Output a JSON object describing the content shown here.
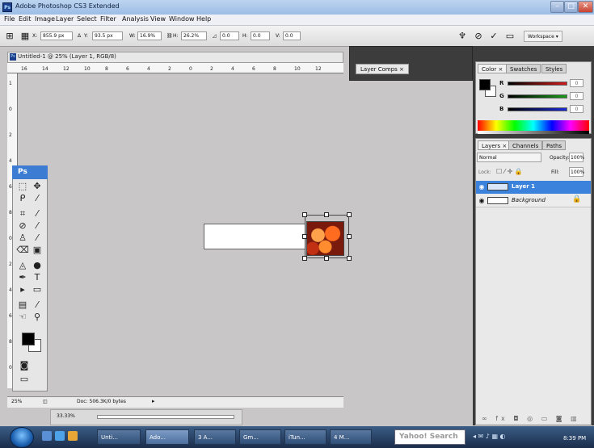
{
  "app": {
    "title": "Adobe Photoshop CS3 Extended",
    "icon_label": "Ps"
  },
  "menu": [
    "File",
    "Edit",
    "Image",
    "Layer",
    "Select",
    "Filter",
    "Analysis",
    "View",
    "Window",
    "Help"
  ],
  "options_bar": {
    "x_label": "X:",
    "x_value": "855.9 px",
    "y_label": "Y:",
    "y_value": "93.5 px",
    "w_label": "W:",
    "w_value": "16.9%",
    "h_label": "H:",
    "h_value": "26.2%",
    "angle_value": "0.0",
    "hskew_label": "H:",
    "hskew_value": "0.0",
    "vskew_label": "V:",
    "vskew_value": "0.0",
    "workspace_label": "Workspace ▾"
  },
  "document": {
    "title": "Untitled-1 @ 25% (Layer 1, RGB/8)",
    "ruler_ticks": [
      "16",
      "14",
      "12",
      "10",
      "8",
      "6",
      "4",
      "2",
      "0",
      "2",
      "4",
      "6",
      "8",
      "10",
      "12"
    ],
    "vruler_ticks": [
      "1",
      "0",
      "2",
      "4",
      "6",
      "8",
      "0",
      "2",
      "4",
      "6",
      "8",
      "0"
    ],
    "status_zoom": "25%",
    "status_doc": "Doc: 506.3K/0 bytes",
    "nav_zoom": "33.33%"
  },
  "layer_comps": {
    "tab": "Layer Comps ×"
  },
  "color_panel": {
    "tabs": [
      "Color ×",
      "Swatches",
      "Styles"
    ],
    "channels": [
      {
        "label": "R",
        "value": "0",
        "color": "#d11b1b"
      },
      {
        "label": "G",
        "value": "0",
        "color": "#1c9b1c"
      },
      {
        "label": "B",
        "value": "0",
        "color": "#1b2bd6"
      }
    ]
  },
  "layers_panel": {
    "tabs": [
      "Layers ×",
      "Channels",
      "Paths"
    ],
    "blend_mode": "Normal",
    "opacity_label": "Opacity:",
    "opacity": "100%",
    "lock_label": "Lock:",
    "fill_label": "Fill:",
    "fill": "100%",
    "layers": [
      {
        "name": "Layer 1",
        "selected": true
      },
      {
        "name": "Background",
        "locked": true
      }
    ],
    "footer": "∞ fx ◘ ◎ ▭ ◙ ▥"
  },
  "taskbar": {
    "items": [
      "Unti...",
      "Ado...",
      "3 A...",
      "Gm...",
      "iTun...",
      "4 M..."
    ],
    "search_text": "Yahoo! Search",
    "clock": "8:39 PM"
  }
}
